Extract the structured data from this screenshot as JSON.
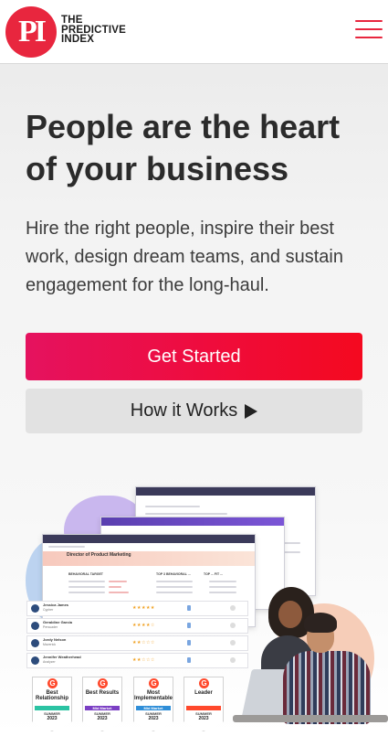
{
  "header": {
    "logo_mark": "PI",
    "logo_text": [
      "THE",
      "PREDICTIVE",
      "INDEX"
    ],
    "menu_icon": "hamburger-icon",
    "accent_color": "#e8263e"
  },
  "hero": {
    "title": "People are the heart of your business",
    "subtitle": "Hire the right people, inspire their best work, design dream teams, and sustain engagement for the long-haul.",
    "primary_button": "Get Started",
    "secondary_button": "How it Works",
    "secondary_icon": "play-icon"
  },
  "illustration": {
    "window_title": "Director of Product Marketing",
    "columns": [
      "BEHAVIORAL TARGET",
      "TOP 3 BEHAVIORAL ...",
      "TOP ... FIT ..."
    ],
    "candidates": [
      {
        "name": "Jessica James",
        "role": "Cypher",
        "stars": "★★★★★"
      },
      {
        "name": "Geraldine Garcia",
        "role": "Persuader",
        "stars": "★★★★☆"
      },
      {
        "name": "Jordy Nelson",
        "role": "Maverick",
        "stars": "★★☆☆☆"
      },
      {
        "name": "Jennifer Weatherhead",
        "role": "Analyzer",
        "stars": "★★☆☆☆"
      }
    ],
    "badges": [
      {
        "title": "Best Relationship",
        "ribbon": "",
        "season": "SUMMER",
        "year": "2023",
        "color": "#2bc3a3"
      },
      {
        "title": "Best Results",
        "ribbon": "Mid Market",
        "season": "SUMMER",
        "year": "2023",
        "color": "#7b3fc4"
      },
      {
        "title": "Most Implementable",
        "ribbon": "Mid Market",
        "season": "SUMMER",
        "year": "2023",
        "color": "#2f8ed8"
      },
      {
        "title": "Leader",
        "ribbon": "",
        "season": "SUMMER",
        "year": "2023",
        "color": "#ff492c"
      }
    ]
  }
}
